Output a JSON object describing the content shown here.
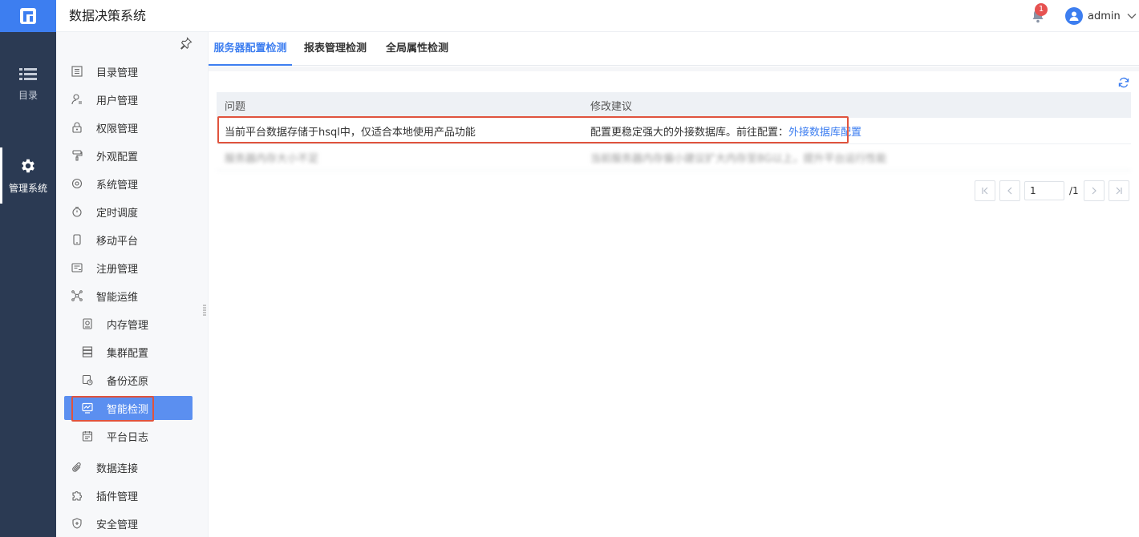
{
  "app": {
    "title": "数据决策系统"
  },
  "rail": {
    "items": [
      {
        "label": "目录",
        "icon": "list-icon"
      },
      {
        "label": "管理系统",
        "icon": "gear-icon"
      }
    ]
  },
  "header": {
    "notification_count": "1",
    "username": "admin"
  },
  "sidebar": {
    "items": [
      {
        "label": "目录管理",
        "icon": "catalog-icon"
      },
      {
        "label": "用户管理",
        "icon": "user-icon"
      },
      {
        "label": "权限管理",
        "icon": "lock-icon"
      },
      {
        "label": "外观配置",
        "icon": "paint-roller-icon"
      },
      {
        "label": "系统管理",
        "icon": "settings-icon"
      },
      {
        "label": "定时调度",
        "icon": "stopwatch-icon"
      },
      {
        "label": "移动平台",
        "icon": "mobile-icon"
      },
      {
        "label": "注册管理",
        "icon": "register-icon"
      },
      {
        "label": "智能运维",
        "icon": "network-icon"
      },
      {
        "label": "内存管理",
        "icon": "memory-icon"
      },
      {
        "label": "集群配置",
        "icon": "cluster-icon"
      },
      {
        "label": "备份还原",
        "icon": "backup-icon"
      },
      {
        "label": "智能检测",
        "icon": "monitor-icon"
      },
      {
        "label": "平台日志",
        "icon": "log-icon"
      },
      {
        "label": "数据连接",
        "icon": "paperclip-icon"
      },
      {
        "label": "插件管理",
        "icon": "puzzle-icon"
      },
      {
        "label": "安全管理",
        "icon": "shield-icon"
      }
    ]
  },
  "tabs": [
    {
      "label": "服务器配置检测"
    },
    {
      "label": "报表管理检测"
    },
    {
      "label": "全局属性检测"
    }
  ],
  "table": {
    "headers": {
      "issue": "问题",
      "suggestion": "修改建议"
    },
    "rows": [
      {
        "issue": "当前平台数据存储于hsql中，仅适合本地使用产品功能",
        "suggestion_text": "配置更稳定强大的外接数据库。前往配置：",
        "suggestion_link": "外接数据库配置"
      },
      {
        "issue": "服务器内存大小不足",
        "suggestion_text": "当前服务器内存偏小建议扩大内存至8G以上，提升平台运行性能"
      }
    ]
  },
  "pager": {
    "current": "1",
    "total": "/1"
  },
  "colors": {
    "accent": "#3d7ef0",
    "rail": "#2b3a53",
    "highlight": "#e0533d"
  }
}
